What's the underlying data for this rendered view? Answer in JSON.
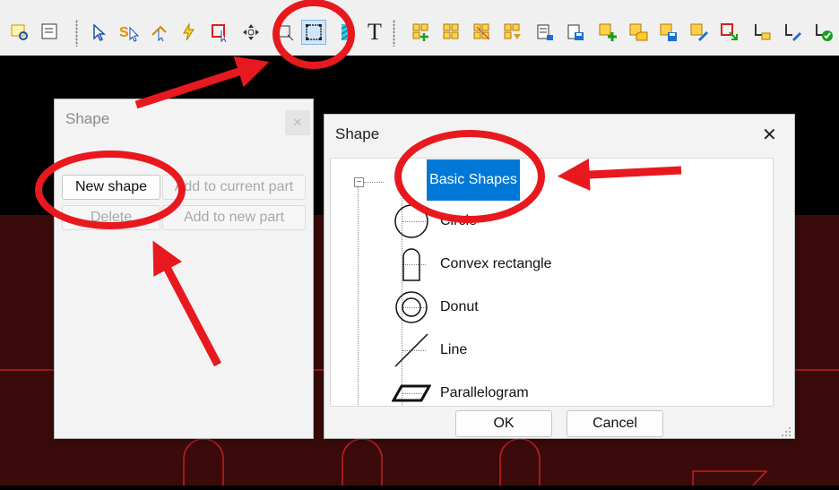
{
  "toolbar": {
    "icons": [
      "zoom-icon",
      "properties-icon",
      "select-arrow-icon",
      "select-s-icon",
      "node-edit-icon",
      "lightning-icon",
      "rect-select-icon",
      "move-icon",
      "resize-icon",
      "shape-frame-icon",
      "fill-icon",
      "text-icon",
      "grid-add-1-icon",
      "grid-add-2-icon",
      "grid-add-3-icon",
      "grid-add-4-icon",
      "list-icon",
      "list-save-icon",
      "add-part-icon",
      "folder-part-icon",
      "save-part-icon",
      "edit-part-icon",
      "export-part-icon",
      "tools-icon",
      "tools-2-icon",
      "tools-check-icon"
    ],
    "text_tool_label": "T"
  },
  "shape_small": {
    "title": "Shape",
    "close_label": "✕",
    "new_shape": "New shape",
    "add_to_current": "Add to current part",
    "delete": "Delete",
    "add_to_new": "Add to new part"
  },
  "shape_large": {
    "title": "Shape",
    "close_label": "✕",
    "tree_toggle": "−",
    "root": "Basic Shapes",
    "items": [
      "Circle",
      "Convex rectangle",
      "Donut",
      "Line",
      "Parallelogram"
    ],
    "ok": "OK",
    "cancel": "Cancel"
  },
  "colors": {
    "annotation_red": "#e8191e",
    "selection_blue": "#0078d7",
    "canvas_red": "#3b0b0b",
    "canvas_line": "#c41e1e"
  }
}
